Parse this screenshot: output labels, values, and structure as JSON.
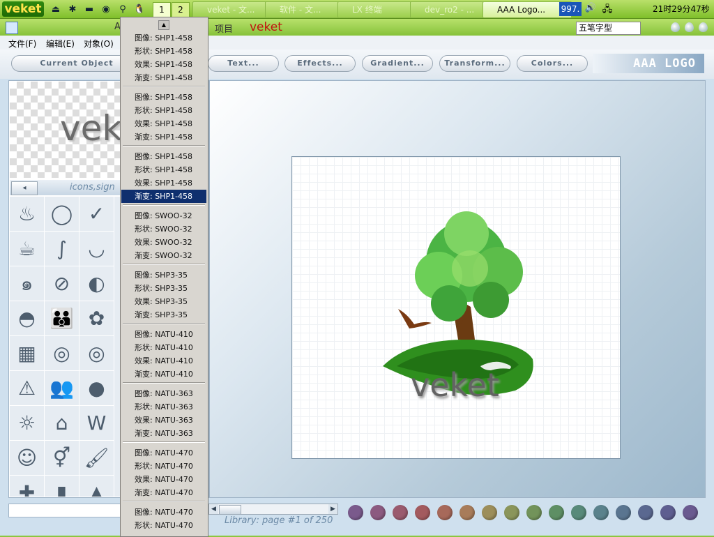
{
  "taskbar": {
    "logo": "veket",
    "workspaces": [
      "1",
      "2"
    ],
    "tasks": [
      "veket - 文...",
      "软件 - 文...",
      "LX 终端",
      "dev_ro2 - ...",
      "AAA Logo..."
    ],
    "indicator": "997.",
    "clock": "21时29分47秒"
  },
  "titlebar": {
    "title_left": "A",
    "title_mid": "项目",
    "brand": "veket",
    "ime": "五笔字型"
  },
  "menu": [
    "文件(F)",
    "编辑(E)",
    "对象(O)"
  ],
  "toolbar": {
    "buttons": [
      "Current Object",
      "Text...",
      "Effects...",
      "Gradient...",
      "Transform...",
      "Colors..."
    ],
    "logo": "AAA LOGO"
  },
  "left_panel": {
    "preview_text": "veke",
    "category": "icons,sign",
    "prev_label": "◂"
  },
  "canvas": {
    "logo_text": "veket"
  },
  "bottom": {
    "library_page": "Library: page #1 of 250"
  },
  "dropdown": {
    "groups": [
      [
        "图像: SHP1-458",
        "形状: SHP1-458",
        "效果: SHP1-458",
        "渐变: SHP1-458"
      ],
      [
        "图像: SHP1-458",
        "形状: SHP1-458",
        "效果: SHP1-458",
        "渐变: SHP1-458"
      ],
      [
        "图像: SHP1-458",
        "形状: SHP1-458",
        "效果: SHP1-458",
        "渐变: SHP1-458"
      ],
      [
        "图像: SWOO-32",
        "形状: SWOO-32",
        "效果: SWOO-32",
        "渐变: SWOO-32"
      ],
      [
        "图像: SHP3-35",
        "形状: SHP3-35",
        "效果: SHP3-35",
        "渐变: SHP3-35"
      ],
      [
        "图像: NATU-410",
        "形状: NATU-410",
        "效果: NATU-410",
        "渐变: NATU-410"
      ],
      [
        "图像: NATU-363",
        "形状: NATU-363",
        "效果: NATU-363",
        "渐变: NATU-363"
      ],
      [
        "图像: NATU-470",
        "形状: NATU-470",
        "效果: NATU-470",
        "渐变: NATU-470"
      ],
      [
        "图像: NATU-470",
        "形状: NATU-470"
      ]
    ],
    "selected": "2.3"
  },
  "colors": {
    "swatches": [
      "#7a5a8c",
      "#8c5a80",
      "#9a5a6e",
      "#a35a5e",
      "#a7695a",
      "#a87c5a",
      "#9c8e5a",
      "#8a955a",
      "#72935a",
      "#5e8f64",
      "#588a7a",
      "#5a828c",
      "#5a7590",
      "#5a6890",
      "#5e5e90",
      "#6a5a90"
    ]
  },
  "icons": [
    "smoke-icon",
    "swirl-ring-icon",
    "swoosh-icon",
    "coffee-cup-icon",
    "squiggle-icon",
    "teacup-icon",
    "wave-icon",
    "no-smoking-icon",
    "moon-face-icon",
    "turtle-icon",
    "family-icon",
    "flower-icon",
    "calculator-icon",
    "spiral-icon",
    "spiral-rings-icon",
    "fire-warning-icon",
    "handshake-icon",
    "flame-icon",
    "sun-house-icon",
    "house-icon",
    "wonder-woman-icon",
    "smiley-icon",
    "gender-icon",
    "paint-brush-icon",
    "cross-icon",
    "stump-icon",
    "tower-icon"
  ]
}
